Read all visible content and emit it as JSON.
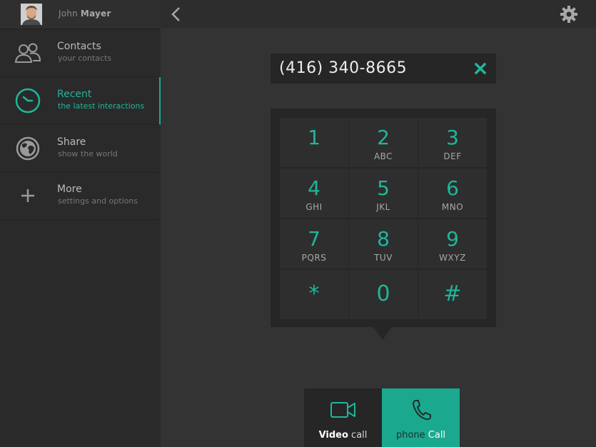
{
  "user": {
    "first_name": "John",
    "last_name": "Mayer"
  },
  "sidebar": {
    "items": [
      {
        "title": "Contacts",
        "subtitle": "your contacts",
        "icon": "contacts-icon"
      },
      {
        "title": "Recent",
        "subtitle": "the latest interactions",
        "icon": "clock-icon",
        "active": true
      },
      {
        "title": "Share",
        "subtitle": "show  the world",
        "icon": "globe-icon"
      },
      {
        "title": "More",
        "subtitle": "settings and options",
        "icon": "plus-icon"
      }
    ]
  },
  "topbar": {
    "back_icon": "chevron-left-icon",
    "settings_icon": "gear-icon"
  },
  "dialer": {
    "number": "(416) 340-8665",
    "clear_icon": "close-icon",
    "keys": [
      {
        "digit": "1",
        "letters": ""
      },
      {
        "digit": "2",
        "letters": "ABC"
      },
      {
        "digit": "3",
        "letters": "DEF"
      },
      {
        "digit": "4",
        "letters": "GHI"
      },
      {
        "digit": "5",
        "letters": "JKL"
      },
      {
        "digit": "6",
        "letters": "MNO"
      },
      {
        "digit": "7",
        "letters": "PQRS"
      },
      {
        "digit": "8",
        "letters": "TUV"
      },
      {
        "digit": "9",
        "letters": "WXYZ"
      },
      {
        "digit": "*",
        "letters": ""
      },
      {
        "digit": "0",
        "letters": ""
      },
      {
        "digit": "#",
        "letters": ""
      }
    ]
  },
  "actions": {
    "video_call": {
      "bold": "Video",
      "rest": " call",
      "icon": "video-camera-icon"
    },
    "phone_call": {
      "bold": "phone",
      "rest": " Call",
      "icon": "phone-icon"
    }
  },
  "colors": {
    "accent": "#1aa98f",
    "sidebar_bg": "#2a2a2a",
    "main_bg": "#333333"
  }
}
